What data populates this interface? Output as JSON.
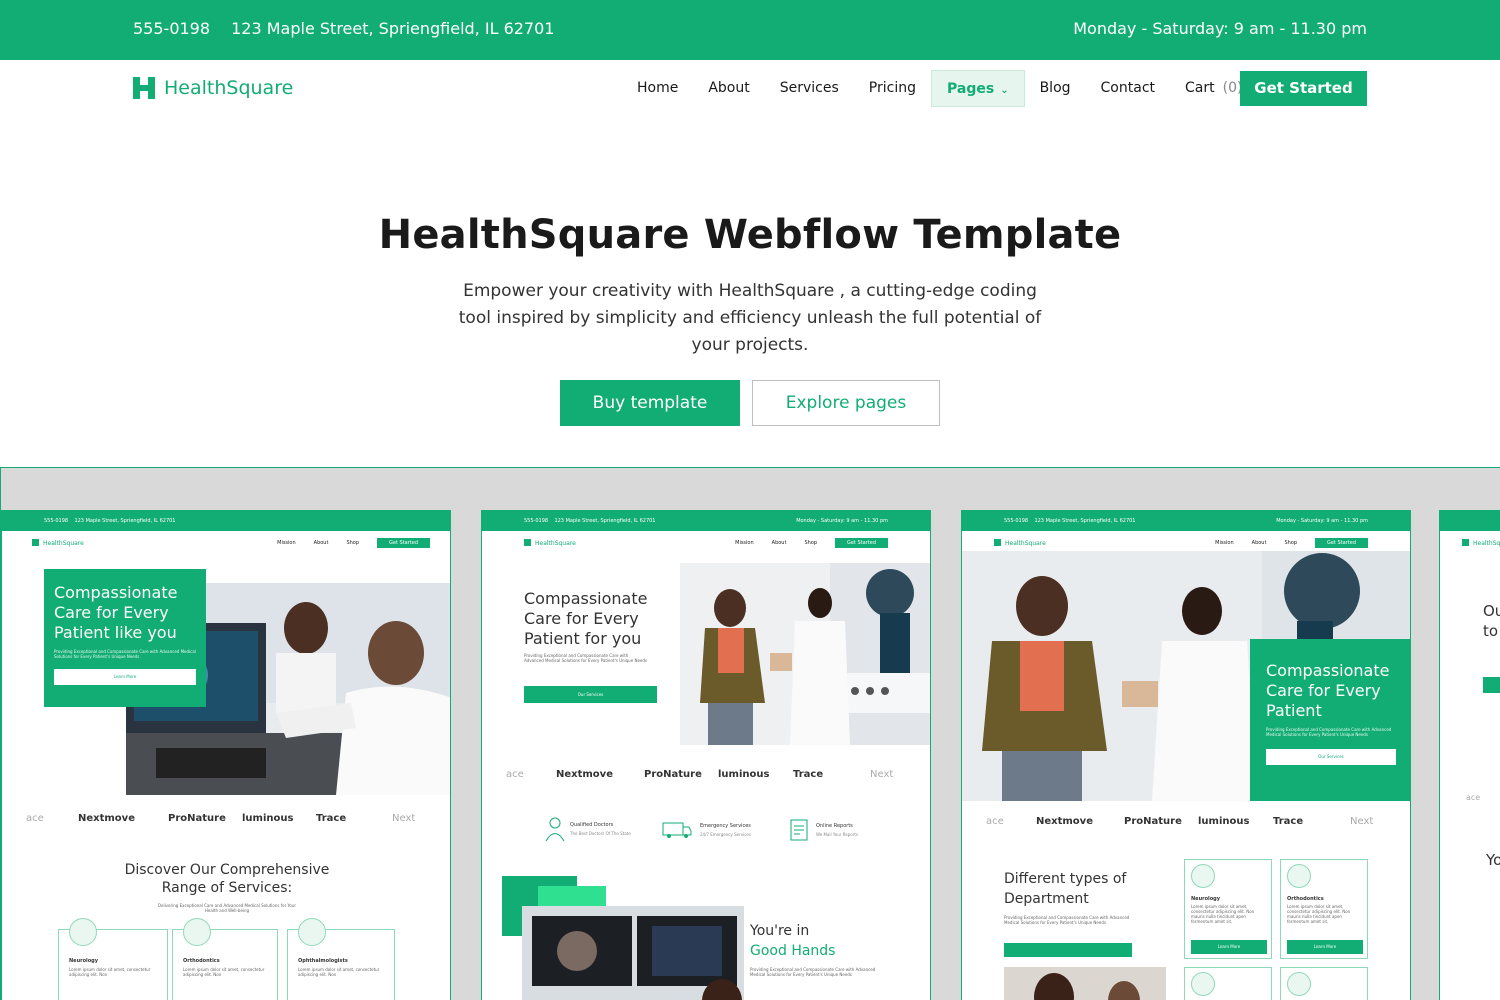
{
  "topbar": {
    "phone": "555-0198",
    "address": "123 Maple Street, Spriengfield, IL 62701",
    "hours": "Monday - Saturday: 9 am - 11.30 pm"
  },
  "brand": {
    "name": "HealthSquare",
    "color": "#12ad74"
  },
  "nav": {
    "items": [
      "Home",
      "About",
      "Services",
      "Pricing",
      "Pages",
      "Blog",
      "Contact",
      "Cart"
    ],
    "cart_count": "(0)",
    "cta": "Get Started"
  },
  "hero": {
    "title": "HealthSquare Webflow Template",
    "description": "Empower your creativity with HealthSquare , a cutting-edge coding tool inspired by simplicity and efficiency unleash the full potential of your projects.",
    "buy": "Buy template",
    "explore": "Explore pages"
  },
  "mini": {
    "phone": "555-0198",
    "address": "123 Maple Street, Spriengfield, IL 62701",
    "hours": "Monday - Saturday: 9 am - 11.30 pm",
    "brand": "HealthSquare",
    "links": [
      "Mission",
      "About",
      "Shop"
    ],
    "cta": "Get Started",
    "logos": [
      "Nextmove",
      "ProNature",
      "luminous",
      "Trace",
      "Next"
    ],
    "logo_partial": "ace"
  },
  "card1": {
    "hero_title": "Compassionate Care for Every Patient like you",
    "hero_sub": "Providing Exceptional and Compassionate Care with Advanced Medical Solutions for Every Patient's Unique Needs",
    "hero_btn": "Learn More",
    "section_title": "Discover Our Comprehensive Range of Services:",
    "section_sub": "Delivering Exceptional Care and Advanced Medical Solutions for Your Health and Well-being",
    "services": [
      {
        "name": "Neurology",
        "text": "Lorem ipsum dolor sit amet, consectetur adipiscing elit. Non"
      },
      {
        "name": "Orthodontics",
        "text": "Lorem ipsum dolor sit amet, consectetur adipiscing elit. Non"
      },
      {
        "name": "Ophthalmologists",
        "text": "Lorem ipsum dolor sit amet, consectetur adipiscing elit. Non"
      }
    ]
  },
  "card2": {
    "hero_title": "Compassionate Care for Every Patient for you",
    "hero_sub": "Providing Exceptional and Compassionate Care with Advanced Medical Solutions for Every Patient's Unique Needs",
    "hero_btn": "Our Services",
    "features": [
      {
        "name": "Qualified Doctors",
        "text": "The Best Doctors Of The State"
      },
      {
        "name": "Emergency Services",
        "text": "24/7 Emergency Services"
      },
      {
        "name": "Online Reports",
        "text": "We Mail Your Reports"
      }
    ],
    "hands_line1": "You're in",
    "hands_line2": "Good Hands",
    "hands_sub": "Providing Exceptional and Compassionate Care with Advanced Medical Solutions for Every Patient's Unique Needs"
  },
  "card3": {
    "hero_title": "Compassionate Care for Every Patient",
    "hero_sub": "Providing Exceptional and Compassionate Care with Advanced Medical Solutions for Every Patient's Unique Needs",
    "hero_btn": "Our Services",
    "section_title": "Different types of Department",
    "section_sub": "Providing Exceptional and Compassionate Care with Advanced Medical Solutions for Every Patient's Unique Needs",
    "services": [
      {
        "name": "Neurology",
        "text": "Lorem ipsum dolor sit amet, consectetur adipiscing elit. Non mauris nulla tincidunt apen fermentum amet sit.",
        "btn": "Learn More"
      },
      {
        "name": "Orthodontics",
        "text": "Lorem ipsum dolor sit amet, consectetur adipiscing elit. Non mauris nulla tincidunt apen fermentum amet sit.",
        "btn": "Learn More"
      }
    ]
  },
  "card4": {
    "title_partial": "Ou to",
    "section_partial": "Yo"
  }
}
